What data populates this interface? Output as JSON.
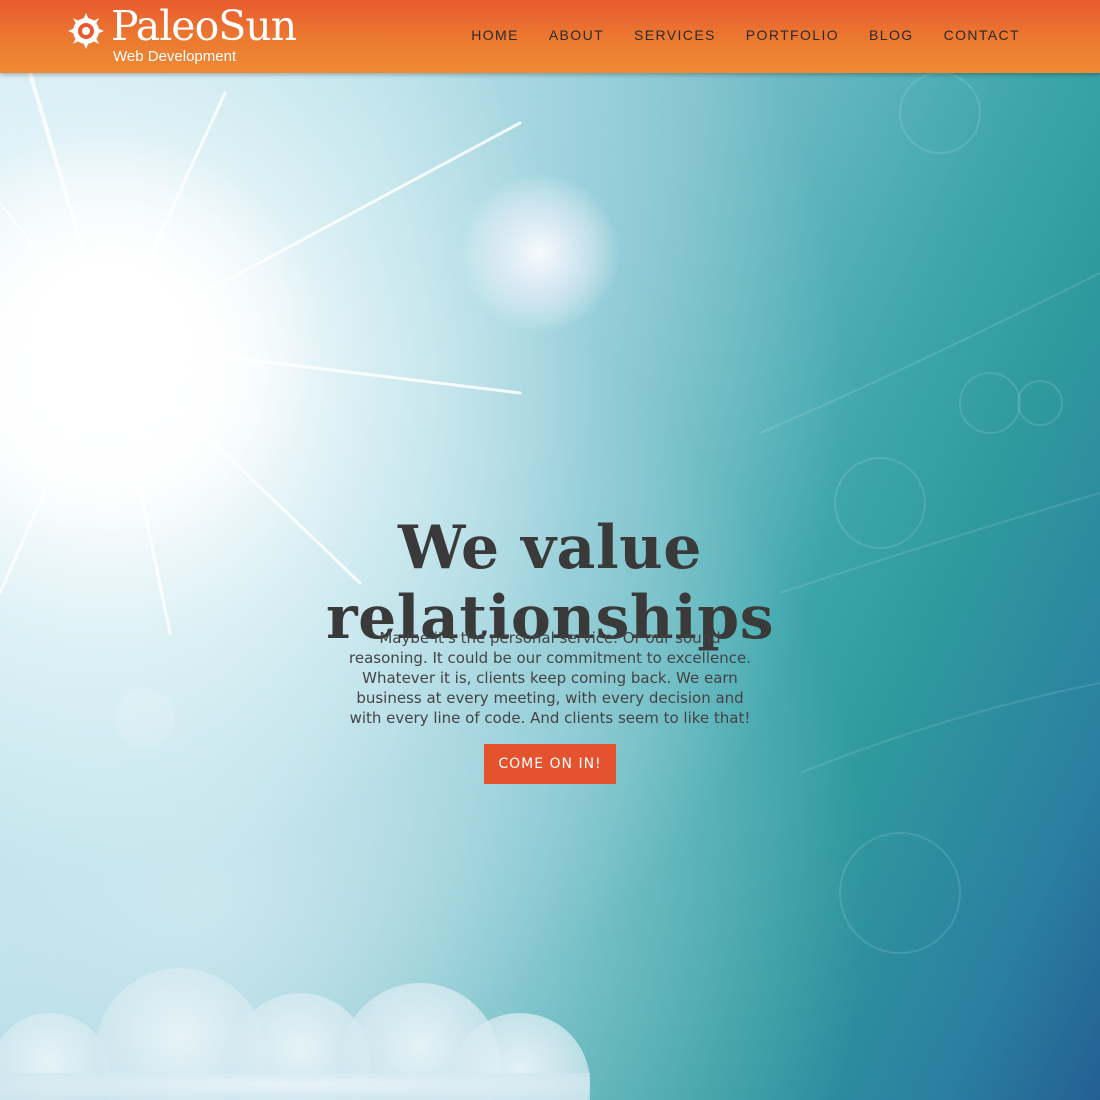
{
  "brand": {
    "name": "PaleoSun",
    "tagline": "Web Development",
    "logo_icon": "sun-spiral-logo-icon"
  },
  "nav": {
    "items": [
      "HOME",
      "ABOUT",
      "SERVICES",
      "PORTFOLIO",
      "BLOG",
      "CONTACT"
    ]
  },
  "hero": {
    "headline_line1": "We value",
    "headline_line2": "relationships",
    "body": "Maybe it's the personal service. Or our sound reasoning. It could be our commitment to excellence. Whatever it is, clients keep coming back. We earn business at every meeting, with every decision and with every line of code. And clients seem to like that!",
    "cta_label": "COME ON IN!"
  },
  "colors": {
    "header_orange": "#e85a2e",
    "cta_orange": "#e4532e",
    "sky_teal": "#2f9a9e",
    "sky_blue": "#245f93"
  }
}
